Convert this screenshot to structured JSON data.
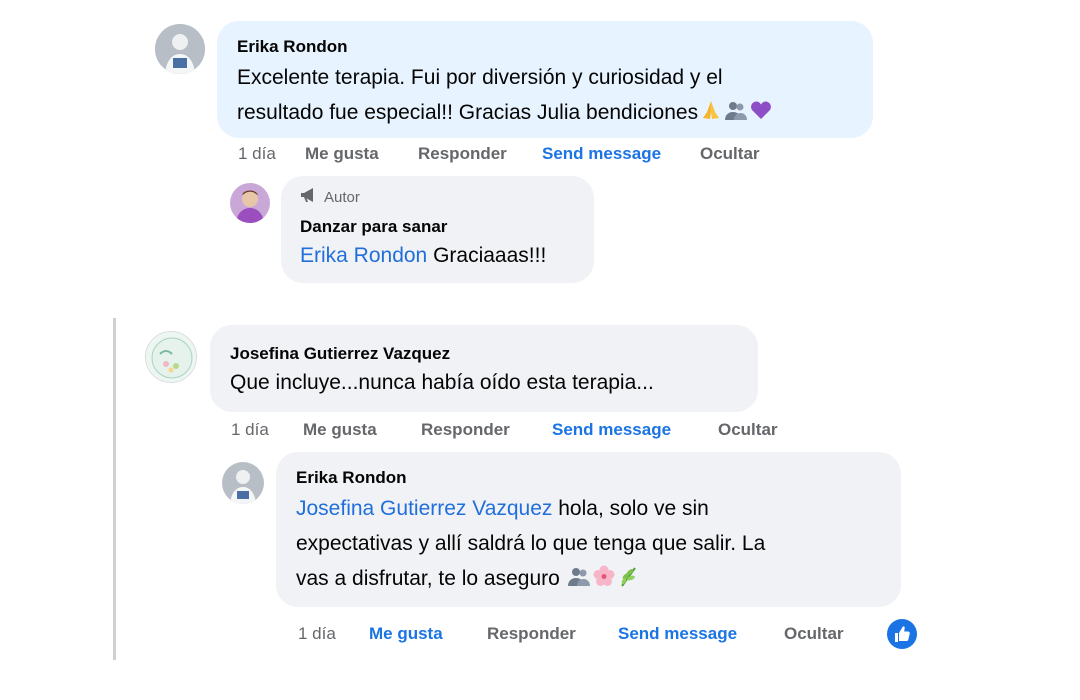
{
  "thread1": {
    "comment": {
      "author": "Erika Rondon",
      "line1": "Excelente terapia. Fui por diversión y curiosidad y el",
      "line2": "resultado fue especial!! Gracias Julia bendiciones",
      "emojis": [
        "folded-hands-icon",
        "busts-icon",
        "purple-heart-icon"
      ]
    },
    "actions": {
      "time": "1 día",
      "like": "Me gusta",
      "reply": "Responder",
      "send": "Send message",
      "hide": "Ocultar"
    },
    "reply": {
      "badge": "Autor",
      "author": "Danzar para sanar",
      "mention": "Erika Rondon",
      "text": " Graciaaas!!!"
    }
  },
  "thread2": {
    "comment": {
      "author": "Josefina Gutierrez Vazquez",
      "text": "Que incluye...nunca había oído esta terapia..."
    },
    "actions": {
      "time": "1 día",
      "like": "Me gusta",
      "reply": "Responder",
      "send": "Send message",
      "hide": "Ocultar"
    },
    "reply": {
      "author": "Erika Rondon",
      "mention": "Josefina Gutierrez Vazquez",
      "line1_rest": " hola, solo ve sin",
      "line2": "expectativas y allí saldrá lo que tenga que salir. La",
      "line3": "vas a disfrutar, te lo aseguro",
      "emojis": [
        "busts-icon",
        "cherry-blossom-icon",
        "herb-icon"
      ]
    },
    "reply_actions": {
      "time": "1 día",
      "like": "Me gusta",
      "reply": "Responder",
      "send": "Send message",
      "hide": "Ocultar",
      "reaction": "like-reaction-icon"
    }
  },
  "colors": {
    "blue_bubble": "#e7f3ff",
    "gray_bubble": "#f0f2f5",
    "link": "#1b74e4",
    "mention": "#216fdb",
    "muted": "#65676b"
  }
}
